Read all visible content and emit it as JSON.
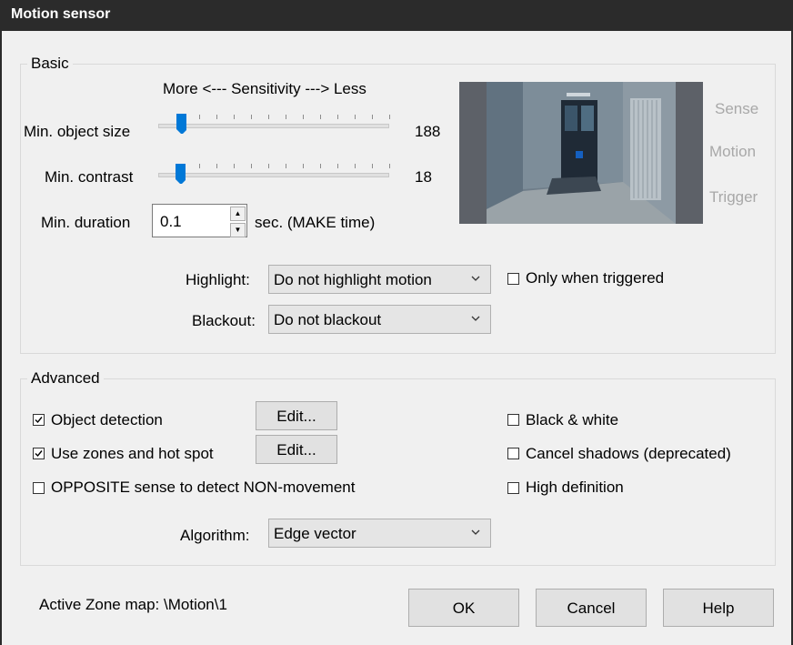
{
  "window": {
    "title": "Motion sensor"
  },
  "basic": {
    "legend": "Basic",
    "sensitivity_header": "More <--- Sensitivity ---> Less",
    "min_object_size": {
      "label": "Min. object size",
      "value": "188",
      "level": 0.2
    },
    "min_contrast": {
      "label": "Min. contrast",
      "value": "18",
      "level": 0.2
    },
    "min_duration": {
      "label": "Min. duration",
      "value": "0.1",
      "units": "sec.  (MAKE time)"
    },
    "preview_labels": {
      "sense": "Sense",
      "motion": "Motion",
      "trigger": "Trigger"
    },
    "highlight": {
      "label": "Highlight:",
      "selected": "Do not highlight motion"
    },
    "only_when_triggered": {
      "label": "Only when triggered",
      "checked": false
    },
    "blackout": {
      "label": "Blackout:",
      "selected": "Do not blackout"
    }
  },
  "advanced": {
    "legend": "Advanced",
    "object_detection": {
      "label": "Object detection",
      "checked": true,
      "edit_label": "Edit..."
    },
    "use_zones": {
      "label": "Use zones and hot spot",
      "checked": true,
      "edit_label": "Edit..."
    },
    "opposite_sense": {
      "label": "OPPOSITE sense to detect NON-movement",
      "checked": false
    },
    "black_white": {
      "label": "Black & white",
      "checked": false
    },
    "cancel_shadows": {
      "label": "Cancel shadows (deprecated)",
      "checked": false
    },
    "high_definition": {
      "label": "High definition",
      "checked": false
    },
    "algorithm": {
      "label": "Algorithm:",
      "selected": "Edge vector"
    }
  },
  "footer": {
    "active_zone_map": "Active Zone map:  \\Motion\\1",
    "ok_label": "OK",
    "cancel_label": "Cancel",
    "help_label": "Help"
  },
  "colors": {
    "titlebar": "#2b2b2b",
    "slider_thumb": "#0078d7",
    "disabled_text": "#a8a8a8"
  },
  "icons": [
    "chevron-down-icon",
    "checkmark-icon",
    "spin-up-icon",
    "spin-down-icon"
  ]
}
